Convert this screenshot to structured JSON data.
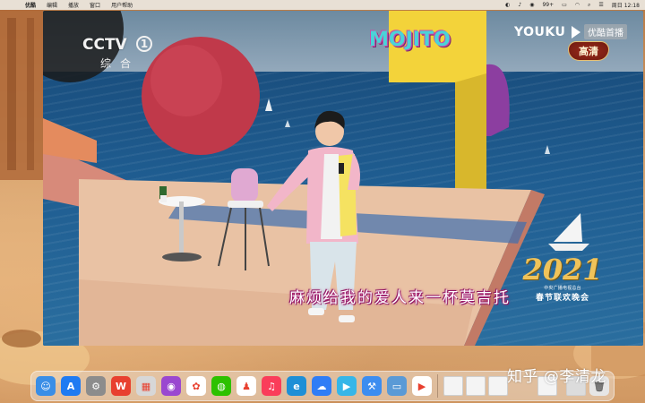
{
  "menubar": {
    "app_name": "优酷",
    "menus": [
      "编辑",
      "播放",
      "窗口",
      "用户帮助"
    ],
    "battery_text": "99+",
    "clock": "周日 12:18"
  },
  "player": {
    "channel_logo": "CCTV",
    "channel_number": "1",
    "channel_sub": "综合",
    "platform_logo": "YOUKU",
    "platform_badge": "优酷首播",
    "quality_badge": "高清",
    "stage_sign": "MOJITO",
    "lyric": "麻烦给我的爱人来一杯莫吉托",
    "gala_year": "2021",
    "gala_org": "中央广播电视总台",
    "gala_title": "春节联欢晚会"
  },
  "dock": {
    "apps": [
      {
        "name": "finder",
        "icon": "finder-icon",
        "color": "#3a8ee6",
        "glyph": "☺"
      },
      {
        "name": "app-store",
        "icon": "app-store-icon",
        "color": "#1f7bf2",
        "glyph": "A"
      },
      {
        "name": "system-preferences",
        "icon": "gear-icon",
        "color": "#8c8c8c",
        "glyph": "⚙"
      },
      {
        "name": "wps",
        "icon": "wps-icon",
        "color": "#e8402f",
        "glyph": "W"
      },
      {
        "name": "launchpad",
        "icon": "launchpad-icon",
        "color": "#d7d7d7",
        "glyph": "▦"
      },
      {
        "name": "podcasts",
        "icon": "podcasts-icon",
        "color": "#9a48d0",
        "glyph": "◉"
      },
      {
        "name": "photos",
        "icon": "photos-icon",
        "color": "#ffffff",
        "glyph": "✿"
      },
      {
        "name": "wechat",
        "icon": "wechat-icon",
        "color": "#2dc100",
        "glyph": "◍"
      },
      {
        "name": "qq",
        "icon": "qq-icon",
        "color": "#ffffff",
        "glyph": "♟"
      },
      {
        "name": "music",
        "icon": "music-icon",
        "color": "#fa3d5a",
        "glyph": "♫"
      },
      {
        "name": "edge",
        "icon": "edge-icon",
        "color": "#1e8fd6",
        "glyph": "e"
      },
      {
        "name": "baidu-netdisk",
        "icon": "cloud-icon",
        "color": "#2f7df6",
        "glyph": "☁"
      },
      {
        "name": "media-player",
        "icon": "play-icon",
        "color": "#36b6e8",
        "glyph": "▶"
      },
      {
        "name": "xcode",
        "icon": "xcode-icon",
        "color": "#3c8df0",
        "glyph": "⚒"
      },
      {
        "name": "preview",
        "icon": "preview-icon",
        "color": "#5a9ad6",
        "glyph": "▭"
      },
      {
        "name": "youku",
        "icon": "youku-icon",
        "color": "#ffffff",
        "glyph": "▶"
      }
    ]
  },
  "watermark": "知乎 @李清龙"
}
